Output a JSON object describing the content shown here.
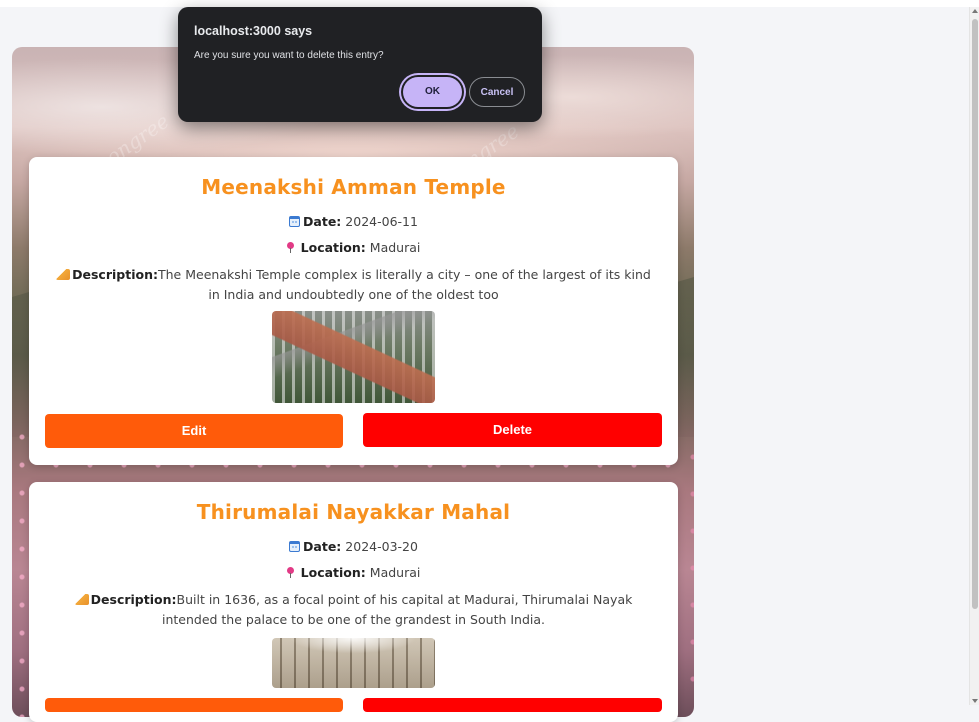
{
  "dialog": {
    "title": "localhost:3000 says",
    "message": "Are you sure you want to delete this entry?",
    "ok_label": "OK",
    "cancel_label": "Cancel"
  },
  "entries": [
    {
      "title": "Meenakshi Amman Temple",
      "date_label": "Date:",
      "date": "2024-06-11",
      "location_label": "Location:",
      "location": "Madurai",
      "description_label": "Description:",
      "description": "The Meenakshi Temple complex is literally a city – one of the largest of its kind in India and undoubtedly one of the oldest too",
      "edit_label": "Edit",
      "delete_label": "Delete"
    },
    {
      "title": "Thirumalai Nayakkar Mahal",
      "date_label": "Date:",
      "date": "2024-03-20",
      "location_label": "Location:",
      "location": "Madurai",
      "description_label": "Description:",
      "description": "Built in 1636, as a focal point of his capital at Madurai, Thirumalai Nayak intended the palace to be one of the grandest in South India."
    }
  ],
  "colors": {
    "title_accent": "#f7911f",
    "edit_button": "#ff5b0a",
    "delete_button": "#ff0000",
    "dialog_background": "#202124",
    "dialog_ok": "#c6b4f7"
  },
  "icons": {
    "date": "calendar-icon",
    "location": "pushpin-icon",
    "description": "writing-hand-icon"
  }
}
